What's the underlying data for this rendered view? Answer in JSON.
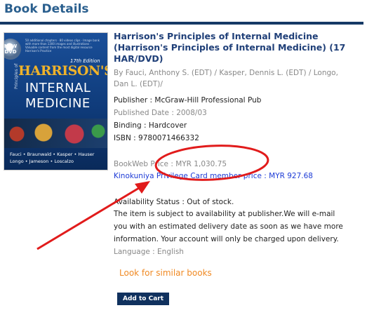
{
  "header": {
    "title": "Book Details"
  },
  "cover": {
    "badge": "NEW DVD",
    "fine_print": "50 additional chapters · 80 videos clips · Image bank with more than 1300 images and illustrations · Valuable content from the most digital resource Harrison's Practice",
    "edition": "17th Edition",
    "title_line1": "HARRISON'S",
    "title_line2": "INTERNAL",
    "title_line3": "MEDICINE",
    "vertical_text": "Principles of",
    "authors_row1": "Fauci • Braunwald • Kasper • Hauser",
    "authors_row2": "Longo • Jameson • Loscalzo"
  },
  "book": {
    "title": "Harrison's Principles of Internal Medicine (Harrison's Principles of Internal Medicine) (17 HAR/DVD)",
    "authors": "By Fauci, Anthony S. (EDT) / Kasper, Dennis L. (EDT) / Longo, Dan L. (EDT)/",
    "publisher": "Publisher : McGraw-Hill Professional Pub",
    "published_date": "Published Date : 2008/03",
    "binding": "Binding : Hardcover",
    "isbn": "ISBN : 9780071466332",
    "bookweb_price": "BookWeb Price : MYR 1,030.75",
    "member_price": "Kinokuniya Privilege Card member price : MYR 927.68",
    "availability": "Availability Status : Out of stock.",
    "note_line1": "The item is subject to availability at publisher.We will e-mail",
    "note_line2": "you with an estimated delivery date as soon as we have more",
    "note_line3": "information. Your account will only be charged upon delivery.",
    "language": "Language : English"
  },
  "actions": {
    "similar_label": "Look for similar books",
    "cart_label": "Add to Cart"
  },
  "colors": {
    "header": "#2a5f8e",
    "rule": "#163a66",
    "title": "#1f3f78",
    "member_price": "#1d3bd6",
    "similar_link": "#f08a24",
    "button": "#10315e",
    "annotation": "#e11b1b"
  }
}
